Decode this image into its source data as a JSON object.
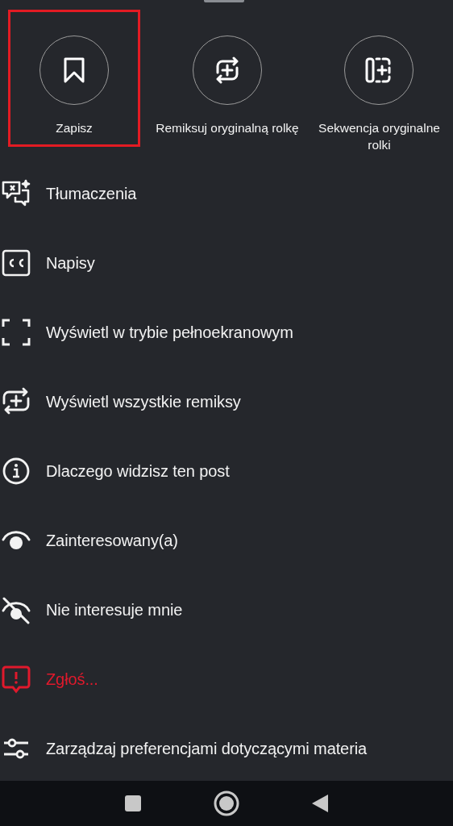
{
  "actions": [
    {
      "label": "Zapisz",
      "highlighted": true
    },
    {
      "label": "Remiksuj oryginalną rolkę",
      "highlighted": false
    },
    {
      "label": "Sekwencja oryginalne rolki",
      "highlighted": false
    }
  ],
  "menu": [
    {
      "label": "Tłumaczenia",
      "kind": "normal"
    },
    {
      "label": "Napisy",
      "kind": "normal"
    },
    {
      "label": "Wyświetl w trybie pełnoekranowym",
      "kind": "normal"
    },
    {
      "label": "Wyświetl wszystkie remiksy",
      "kind": "normal"
    },
    {
      "label": "Dlaczego widzisz ten post",
      "kind": "normal"
    },
    {
      "label": "Zainteresowany(a)",
      "kind": "normal"
    },
    {
      "label": "Nie interesuje mnie",
      "kind": "normal"
    },
    {
      "label": "Zgłoś...",
      "kind": "danger"
    },
    {
      "label": "Zarządzaj preferencjami dotyczącymi materia",
      "kind": "normal"
    }
  ]
}
